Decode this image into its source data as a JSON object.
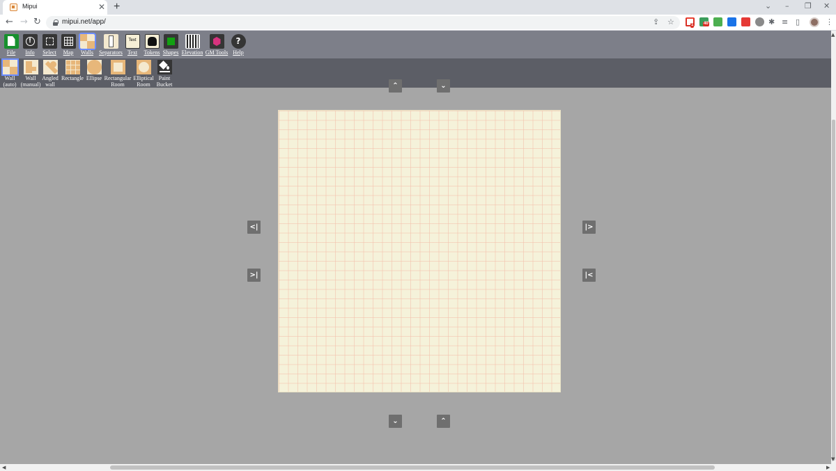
{
  "browser": {
    "tab_title": "Mipui",
    "tab_close": "✕",
    "new_tab": "+",
    "url": "mipui.net/app/",
    "nav": {
      "back": "←",
      "forward": "→",
      "reload": "↻"
    },
    "window": {
      "chevron": "⌄",
      "minimize": "–",
      "restore": "❐",
      "close": "✕"
    },
    "omni_icons": {
      "share": "⇪",
      "bookmark": "☆"
    },
    "extensions": [
      {
        "name": "gmail-extension",
        "color": "#ffffff",
        "badge": "1"
      },
      {
        "name": "house-extension",
        "color": "#3a9d5b",
        "badge": "40"
      },
      {
        "name": "green-extension",
        "color": "#4caf50",
        "badge": ""
      },
      {
        "name": "blue-extension",
        "color": "#1a73e8",
        "badge": ""
      },
      {
        "name": "red-extension",
        "color": "#e53935",
        "badge": ""
      },
      {
        "name": "grey-extension",
        "color": "#8a8a8a",
        "badge": ""
      }
    ]
  },
  "toolbar": {
    "tools": [
      {
        "label": "File"
      },
      {
        "label": "Info"
      },
      {
        "label": "Select"
      },
      {
        "label": "Map"
      },
      {
        "label": "Walls"
      },
      {
        "label": "Separators"
      },
      {
        "label": "Text",
        "icon_text": "Text"
      },
      {
        "label": "Tokens"
      },
      {
        "label": "Shapes"
      },
      {
        "label": "Elevation"
      },
      {
        "label": "GM Tools"
      },
      {
        "label": "Help",
        "icon_text": "?"
      }
    ],
    "selected": "Walls"
  },
  "wall_tools": [
    {
      "line1": "Wall",
      "line2": "(auto)"
    },
    {
      "line1": "Wall",
      "line2": "(manual)"
    },
    {
      "line1": "Angled",
      "line2": "wall"
    },
    {
      "line1": "Rectangle",
      "line2": ""
    },
    {
      "line1": "Ellipse",
      "line2": ""
    },
    {
      "line1": "Rectangular",
      "line2": "Room"
    },
    {
      "line1": "Elliptical",
      "line2": "Room"
    },
    {
      "line1": "Paint",
      "line2": "Bucket"
    }
  ],
  "canvas": {
    "arrows": {
      "top_expand": "⌃",
      "top_shrink": "⌄",
      "left_expand": "<|",
      "left_shrink": ">|",
      "right_expand": "|>",
      "right_shrink": "|<",
      "bottom_expand": "⌄",
      "bottom_shrink": "⌃"
    }
  }
}
